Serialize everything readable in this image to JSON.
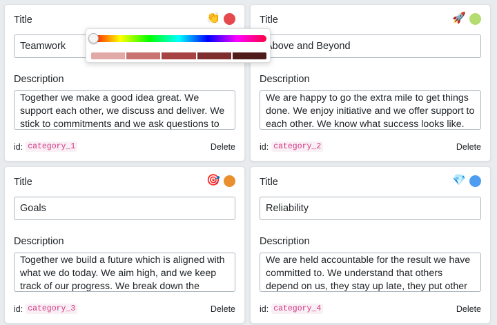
{
  "labels": {
    "title": "Title",
    "description": "Description",
    "id_prefix": "id:",
    "delete": "Delete"
  },
  "cards": [
    {
      "title": "Teamwork",
      "description": "Together we make a good idea great. We support each other, we discuss and deliver. We stick to commitments and we ask questions to find out",
      "id": "category_1",
      "emoji": "👏",
      "emoji_name": "clapping-hands-icon",
      "color": "#e5484d"
    },
    {
      "title": "Above and Beyond",
      "description": "We are happy to go the extra mile to get things done. We enjoy initiative and we offer support to each other. We know what success looks like.",
      "id": "category_2",
      "emoji": "🚀",
      "emoji_name": "rocket-icon",
      "color": "#b5dc70"
    },
    {
      "title": "Goals",
      "description": "Together we build a future which is aligned with what we do today. We aim high, and we keep track of our progress. We break down the",
      "id": "category_3",
      "emoji": "🎯",
      "emoji_name": "target-icon",
      "color": "#e98f2e"
    },
    {
      "title": "Reliability",
      "description": "We are held accountable for the result we have committed to. We understand that others depend on us, they stay up late, they put other plans on",
      "id": "category_4",
      "emoji": "💎",
      "emoji_name": "gem-icon",
      "color": "#4d9ef0"
    }
  ],
  "color_picker": {
    "hue": 0,
    "shades": [
      "#e2a9a9",
      "#c97373",
      "#a84343",
      "#7f2e2e",
      "#4f1c1c"
    ]
  }
}
